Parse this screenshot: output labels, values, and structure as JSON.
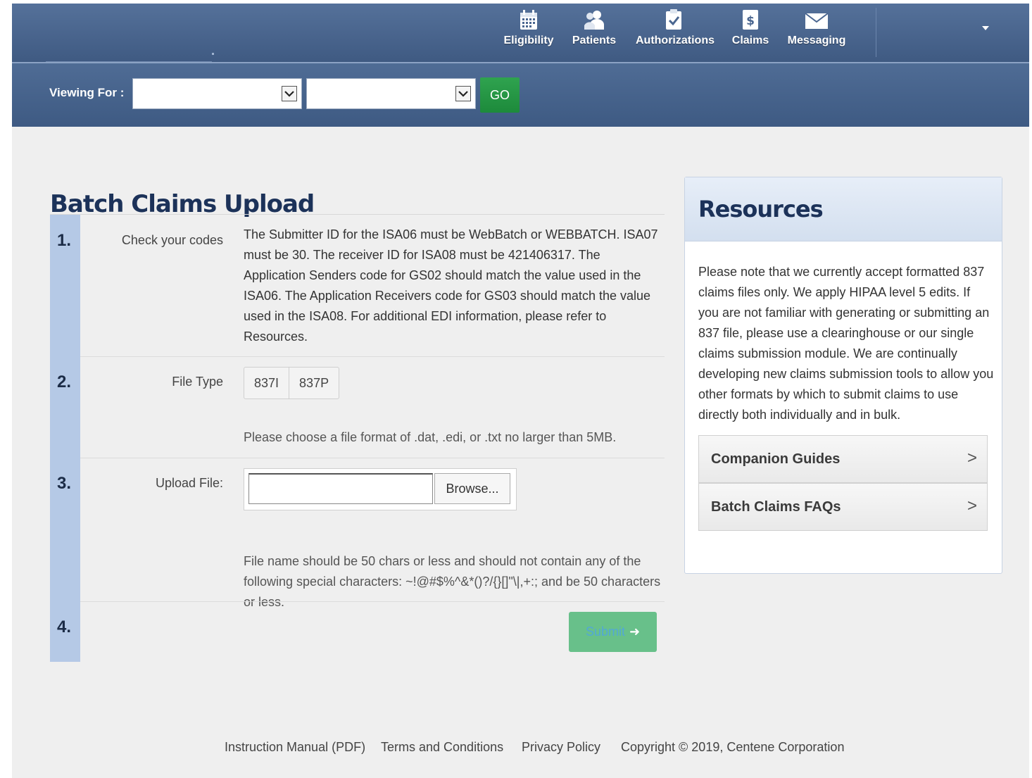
{
  "nav": {
    "items": [
      {
        "label": "Eligibility",
        "icon": "calendar-icon"
      },
      {
        "label": "Patients",
        "icon": "users-icon"
      },
      {
        "label": "Authorizations",
        "icon": "checklist-icon"
      },
      {
        "label": "Claims",
        "icon": "dollar-document-icon"
      },
      {
        "label": "Messaging",
        "icon": "envelope-icon"
      }
    ]
  },
  "viewbar": {
    "label": "Viewing For :",
    "select1_value": "",
    "select2_value": "",
    "go_label": "GO"
  },
  "main": {
    "title": "Batch Claims Upload",
    "steps": [
      {
        "num": "1.",
        "label": "Check your codes",
        "text": "The Submitter ID for the ISA06 must be WebBatch or WEBBATCH. ISA07 must be 30. The receiver ID for ISA08 must be 421406317. The Application Senders code for GS02 should match the value used in the ISA06. The Application Receivers code for GS03 should match the value used in the ISA08. For additional EDI information, please refer to Resources."
      },
      {
        "num": "2.",
        "label": "File Type",
        "options": [
          "837I",
          "837P"
        ],
        "hint": "Please choose a file format of .dat, .edi, or .txt no larger than 5MB."
      },
      {
        "num": "3.",
        "label": "Upload File:",
        "browse_label": "Browse...",
        "hint": "File name should be 50 chars or less and should not contain any of the following special characters: ~!@#$%^&*()?/{}[]\"\\|,+:; and be 50 characters or less."
      },
      {
        "num": "4.",
        "submit_label": "Submit",
        "submit_arrow": "➜"
      }
    ]
  },
  "resources": {
    "title": "Resources",
    "text": "Please note that we currently accept formatted 837 claims files only. We apply HIPAA level 5 edits. If you are not familiar with generating or submitting an 837 file, please use a clearinghouse or our single claims submission module. We are continually developing new claims submission tools to allow you other formats by which to submit claims to use directly both individually and in bulk.",
    "links": [
      {
        "label": "Companion Guides",
        "chevron": ">"
      },
      {
        "label": "Batch Claims FAQs",
        "chevron": ">"
      }
    ]
  },
  "footer": {
    "manual": "Instruction Manual (PDF)",
    "terms": "Terms and Conditions",
    "privacy": "Privacy Policy",
    "copyright": "Copyright © 2019, Centene Corporation"
  }
}
